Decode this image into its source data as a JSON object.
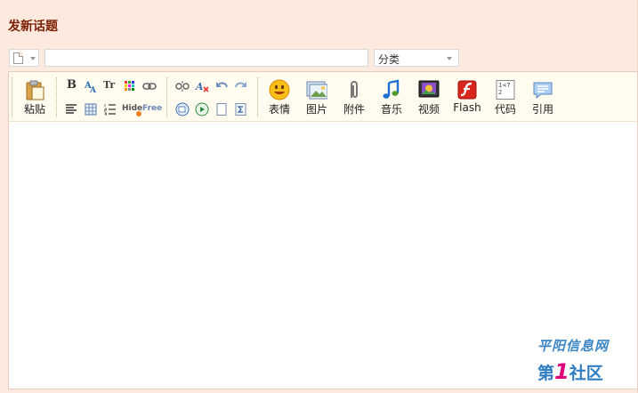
{
  "page": {
    "title": "发新话题"
  },
  "form": {
    "title_value": "",
    "title_placeholder": "",
    "category_selected": "分类"
  },
  "toolbar": {
    "paste_label": "粘贴",
    "emoticon_label": "表情",
    "image_label": "图片",
    "attachment_label": "附件",
    "music_label": "音乐",
    "video_label": "视频",
    "flash_label": "Flash",
    "code_label": "代码",
    "quote_label": "引用",
    "hide_label": "Hide",
    "free_label": "Free",
    "bold_label": "B",
    "font_label": "Tr"
  },
  "watermark": {
    "line1": "平阳信息网",
    "line2_prefix": "第",
    "line2_num": "1",
    "line2_suffix": "社区"
  },
  "colors": {
    "background": "#fde9de",
    "toolbar_bg": "#fffbee",
    "title_color": "#7a1f00",
    "watermark_blue": "#2f7dc2",
    "watermark_pink": "#e0007a"
  }
}
